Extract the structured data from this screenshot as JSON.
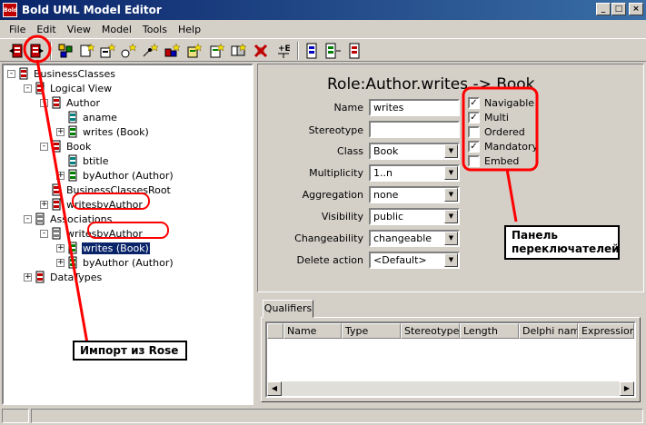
{
  "window": {
    "title": "Bold UML Model Editor",
    "app_icon_text": "Bold",
    "minimize": "_",
    "maximize": "□",
    "close": "×"
  },
  "menu": [
    "File",
    "Edit",
    "View",
    "Model",
    "Tools",
    "Help"
  ],
  "toolbar": {
    "buttons": [
      "import-icon",
      "export-icon",
      "check-model-icon",
      "new-class-icon",
      "new-attribute-icon",
      "new-method-icon",
      "new-package-icon",
      "new-association-icon",
      "new-role-icon",
      "delete-icon",
      "tagged-values-icon",
      "view-1-icon",
      "view-2-icon",
      "view-3-icon"
    ]
  },
  "tree": {
    "items": [
      {
        "label": "BusinessClasses",
        "level": 0,
        "expander": "-",
        "icon": "package"
      },
      {
        "label": "Logical View",
        "level": 1,
        "expander": "-",
        "icon": "package"
      },
      {
        "label": "Author",
        "level": 2,
        "expander": "-",
        "icon": "class"
      },
      {
        "label": "aname",
        "level": 3,
        "expander": "",
        "icon": "attribute"
      },
      {
        "label": "writes (Book)",
        "level": 3,
        "expander": "+",
        "icon": "role"
      },
      {
        "label": "Book",
        "level": 2,
        "expander": "-",
        "icon": "class"
      },
      {
        "label": "btitle",
        "level": 3,
        "expander": "",
        "icon": "attribute"
      },
      {
        "label": "byAuthor (Author)",
        "level": 3,
        "expander": "+",
        "icon": "role"
      },
      {
        "label": "BusinessClassesRoot",
        "level": 2,
        "expander": "",
        "icon": "class"
      },
      {
        "label": "writesbyAuthor",
        "level": 2,
        "expander": "+",
        "icon": "class"
      },
      {
        "label": "Associations",
        "level": 1,
        "expander": "-",
        "icon": "assoc"
      },
      {
        "label": "writesbyAuthor",
        "level": 2,
        "expander": "-",
        "icon": "assoc"
      },
      {
        "label": "writes (Book)",
        "level": 3,
        "expander": "+",
        "icon": "role",
        "selected": true
      },
      {
        "label": "byAuthor (Author)",
        "level": 3,
        "expander": "+",
        "icon": "role"
      },
      {
        "label": "DataTypes",
        "level": 1,
        "expander": "+",
        "icon": "package"
      }
    ]
  },
  "role_editor": {
    "title": "Role:Author.writes -> Book",
    "fields": {
      "name": {
        "label": "Name",
        "value": "writes"
      },
      "stereotype": {
        "label": "Stereotype",
        "value": ""
      },
      "class": {
        "label": "Class",
        "value": "Book"
      },
      "multiplicity": {
        "label": "Multiplicity",
        "value": "1..n"
      },
      "aggregation": {
        "label": "Aggregation",
        "value": "none"
      },
      "visibility": {
        "label": "Visibility",
        "value": "public"
      },
      "changeability": {
        "label": "Changeability",
        "value": "changeable"
      },
      "delete_action": {
        "label": "Delete action",
        "value": "<Default>"
      }
    },
    "checkboxes": [
      {
        "label": "Navigable",
        "checked": true
      },
      {
        "label": "Multi",
        "checked": true
      },
      {
        "label": "Ordered",
        "checked": false
      },
      {
        "label": "Mandatory",
        "checked": true
      },
      {
        "label": "Embed",
        "checked": false
      }
    ],
    "check_mark": "✓"
  },
  "qualifiers": {
    "tab": "Qualifiers",
    "columns": [
      "Name",
      "Type",
      "Stereotype",
      "Length",
      "Delphi name",
      "Expression n"
    ]
  },
  "annotations": {
    "import_callout": "Импорт из Rose",
    "switch_panel_line1": "Панель",
    "switch_panel_line2": "переключателей",
    "color": "#ff0000"
  }
}
